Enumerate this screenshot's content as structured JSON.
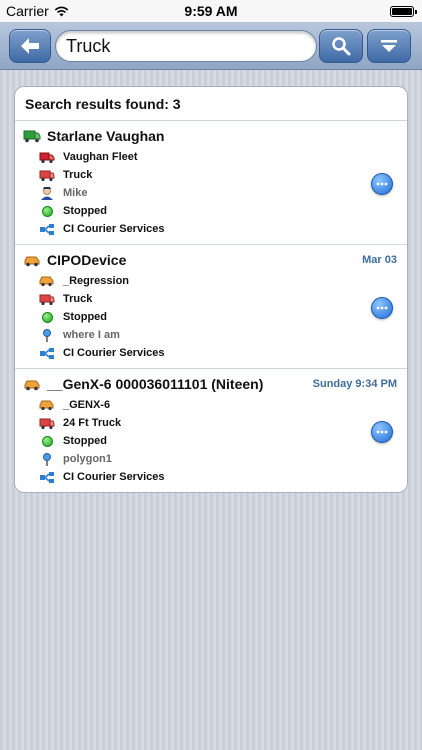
{
  "status_bar": {
    "carrier": "Carrier",
    "time": "9:59 AM"
  },
  "toolbar": {
    "search_value": "Truck",
    "back_icon": "arrow-left-icon",
    "search_icon": "search-icon",
    "filter_icon": "chevron-down-icon"
  },
  "results": {
    "header": "Search results found: 3",
    "items": [
      {
        "title": "Starlane Vaughan",
        "date": "",
        "details": [
          {
            "icon": "truck-icon",
            "text": "Vaughan Fleet"
          },
          {
            "icon": "firetruck-icon",
            "text": "Truck"
          },
          {
            "icon": "driver-icon",
            "text": "Mike"
          },
          {
            "icon": "status-dot-icon",
            "text": "Stopped"
          },
          {
            "icon": "hierarchy-icon",
            "text": "CI Courier Services"
          }
        ]
      },
      {
        "title": "CIPODevice",
        "date": "Mar 03",
        "details": [
          {
            "icon": "car-icon",
            "text": "_Regression"
          },
          {
            "icon": "firetruck-icon",
            "text": "Truck"
          },
          {
            "icon": "status-dot-icon",
            "text": "Stopped"
          },
          {
            "icon": "pin-icon",
            "text": "where I am"
          },
          {
            "icon": "hierarchy-icon",
            "text": "CI Courier Services"
          }
        ]
      },
      {
        "title": "__GenX-6 000036011101 (Niteen)",
        "date": "Sunday 9:34 PM",
        "details": [
          {
            "icon": "car-icon",
            "text": "_GENX-6"
          },
          {
            "icon": "firetruck-icon",
            "text": "24 Ft Truck"
          },
          {
            "icon": "status-dot-icon",
            "text": "Stopped"
          },
          {
            "icon": "pin-icon",
            "text": "polygon1"
          },
          {
            "icon": "hierarchy-icon",
            "text": "CI Courier Services"
          }
        ]
      }
    ]
  },
  "colors": {
    "accent": "#3f6aa6",
    "date_text": "#3f6d9e",
    "status_green": "#1aa61a"
  }
}
